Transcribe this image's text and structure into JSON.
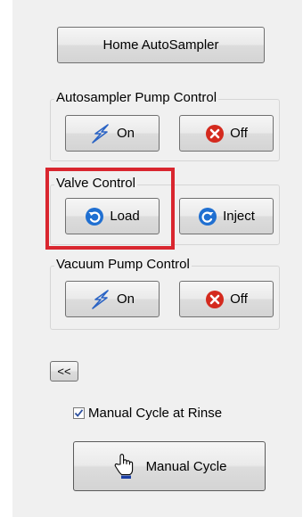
{
  "home_button": {
    "label": "Home AutoSampler"
  },
  "autosampler_pump": {
    "title": "Autosampler Pump Control",
    "on_label": "On",
    "off_label": "Off"
  },
  "valve_control": {
    "title": "Valve Control",
    "load_label": "Load",
    "inject_label": "Inject"
  },
  "vacuum_pump": {
    "title": "Vacuum Pump Control",
    "on_label": "On",
    "off_label": "Off"
  },
  "collapse_button": {
    "label": "<<"
  },
  "manual_cycle_rinse": {
    "label": "Manual Cycle at Rinse",
    "checked": true
  },
  "manual_cycle_button": {
    "label": "Manual Cycle"
  },
  "icons": {
    "on": "lightning-icon",
    "off": "red-x-icon",
    "load": "blue-undo-icon",
    "inject": "blue-redo-icon",
    "manual_cycle": "hand-pointer-icon"
  },
  "colors": {
    "highlight": "#d9262f",
    "bolt": "#2a63c4",
    "off_red": "#d42a1e",
    "blue_circle": "#1f6fd1"
  }
}
